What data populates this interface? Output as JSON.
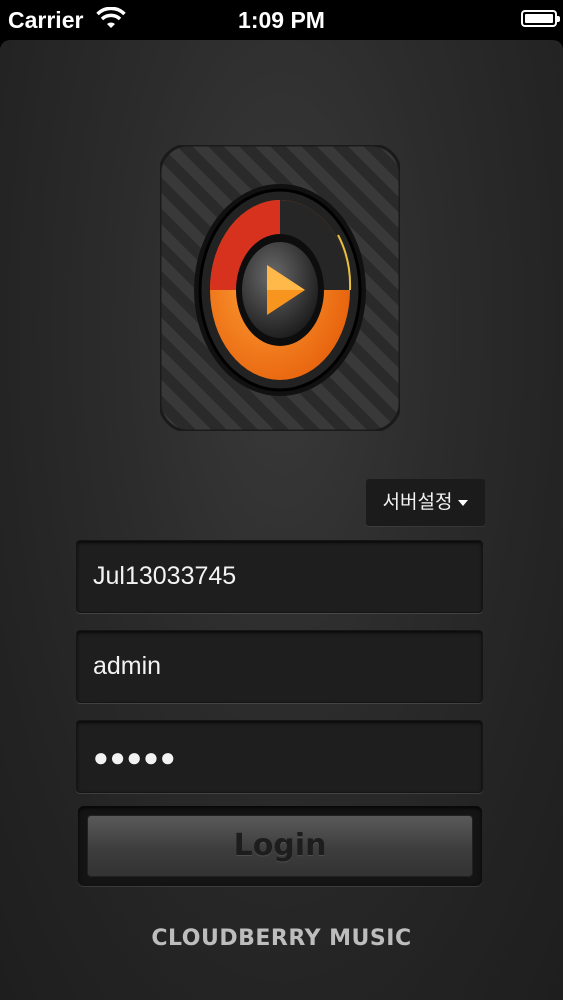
{
  "status_bar": {
    "carrier": "Carrier",
    "time": "1:09 PM"
  },
  "server_settings": {
    "label": "서버설정"
  },
  "form": {
    "id_value": "Jul13033745",
    "user_value": "admin",
    "password_mask": "●●●●●",
    "login_label": "Login"
  },
  "footer": {
    "brand": "CLOUDBERRY MUSIC"
  },
  "colors": {
    "accent_orange": "#f07a1a",
    "accent_red": "#d8321e",
    "background": "#2c2c2c"
  }
}
